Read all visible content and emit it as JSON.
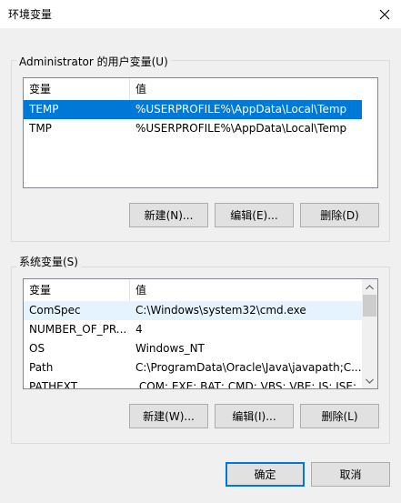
{
  "window": {
    "title": "环境变量"
  },
  "user_vars": {
    "label": "Administrator 的用户变量(U)",
    "columns": [
      "变量",
      "值"
    ],
    "rows": [
      {
        "name": "TEMP",
        "value": "%USERPROFILE%\\AppData\\Local\\Temp"
      },
      {
        "name": "TMP",
        "value": "%USERPROFILE%\\AppData\\Local\\Temp"
      }
    ],
    "new_label": "新建(N)...",
    "edit_label": "编辑(E)...",
    "delete_label": "删除(D)"
  },
  "system_vars": {
    "label": "系统变量(S)",
    "columns": [
      "变量",
      "值"
    ],
    "rows": [
      {
        "name": "ComSpec",
        "value": "C:\\Windows\\system32\\cmd.exe"
      },
      {
        "name": "NUMBER_OF_PR...",
        "value": "4"
      },
      {
        "name": "OS",
        "value": "Windows_NT"
      },
      {
        "name": "Path",
        "value": "C:\\ProgramData\\Oracle\\Java\\javapath;C..."
      },
      {
        "name": "PATHEXT",
        "value": ".COM;.EXE;.BAT;.CMD;.VBS;.VBE;.JS;.JSE;..."
      }
    ],
    "new_label": "新建(W)...",
    "edit_label": "编辑(I)...",
    "delete_label": "删除(L)"
  },
  "footer": {
    "ok_label": "确定",
    "cancel_label": "取消"
  },
  "colors": {
    "selection": "#0078d7",
    "hover": "#e5f3ff"
  }
}
